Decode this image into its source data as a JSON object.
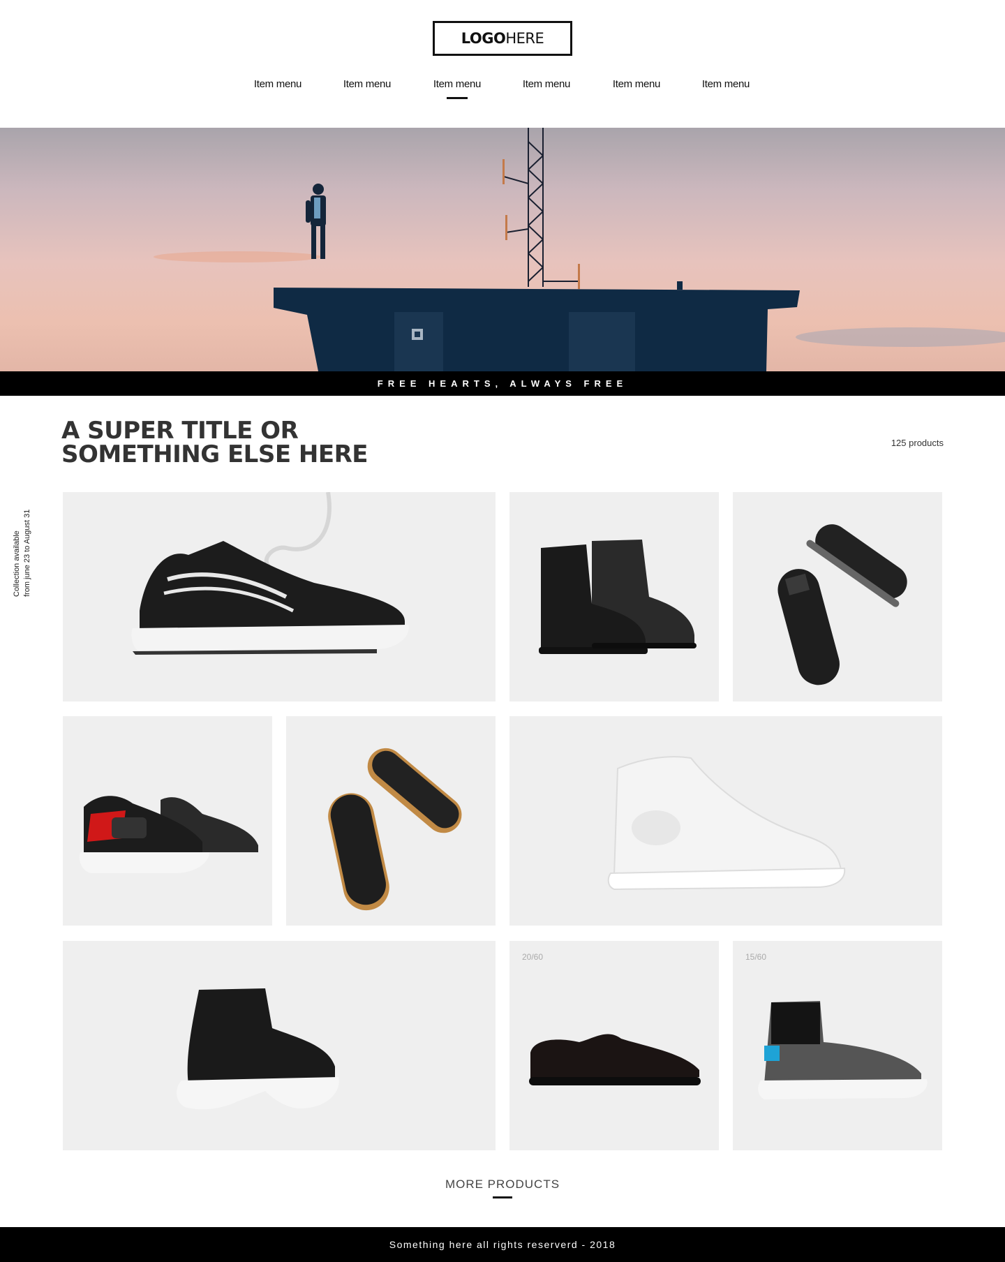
{
  "header": {
    "logo_bold": "LOGO",
    "logo_light": "HERE",
    "nav": [
      "Item menu",
      "Item menu",
      "Item menu",
      "Item menu",
      "Item menu",
      "Item menu"
    ],
    "active_nav_index": 2
  },
  "hero": {
    "image": "man-on-rooftop-at-sunset",
    "ribbon_text": "FREE HEARTS, ALWAYS FREE"
  },
  "main": {
    "title_line1": "A SUPER TITLE OR",
    "title_line2": "SOMETHING ELSE HERE",
    "product_count": "125 products",
    "side_note_line1": "Collection available",
    "side_note_line2": "from june 23 to August 31",
    "products": [
      {
        "image": "black-runner-sneaker-with-white-laces-icon",
        "badge": ""
      },
      {
        "image": "black-lace-up-boots-icon",
        "badge": ""
      },
      {
        "image": "black-sneakers-top-view-icon",
        "badge": ""
      },
      {
        "image": "black-red-strap-sneakers-icon",
        "badge": ""
      },
      {
        "image": "black-sneakers-gum-sole-icon",
        "badge": ""
      },
      {
        "image": "white-high-top-sneaker-icon",
        "badge": ""
      },
      {
        "image": "black-sock-sneaker-icon",
        "badge": ""
      },
      {
        "image": "black-suede-derby-shoe-icon",
        "badge": "20/60"
      },
      {
        "image": "grey-sock-runner-sneaker-icon",
        "badge": "15/60"
      }
    ],
    "more_label": "MORE PRODUCTS"
  },
  "footer": {
    "text": "Something here all rights reserverd - 2018"
  },
  "colors": {
    "ink": "#111111",
    "card_bg": "#efefef",
    "bar_bg": "#000000",
    "building": "#0f2a44"
  }
}
